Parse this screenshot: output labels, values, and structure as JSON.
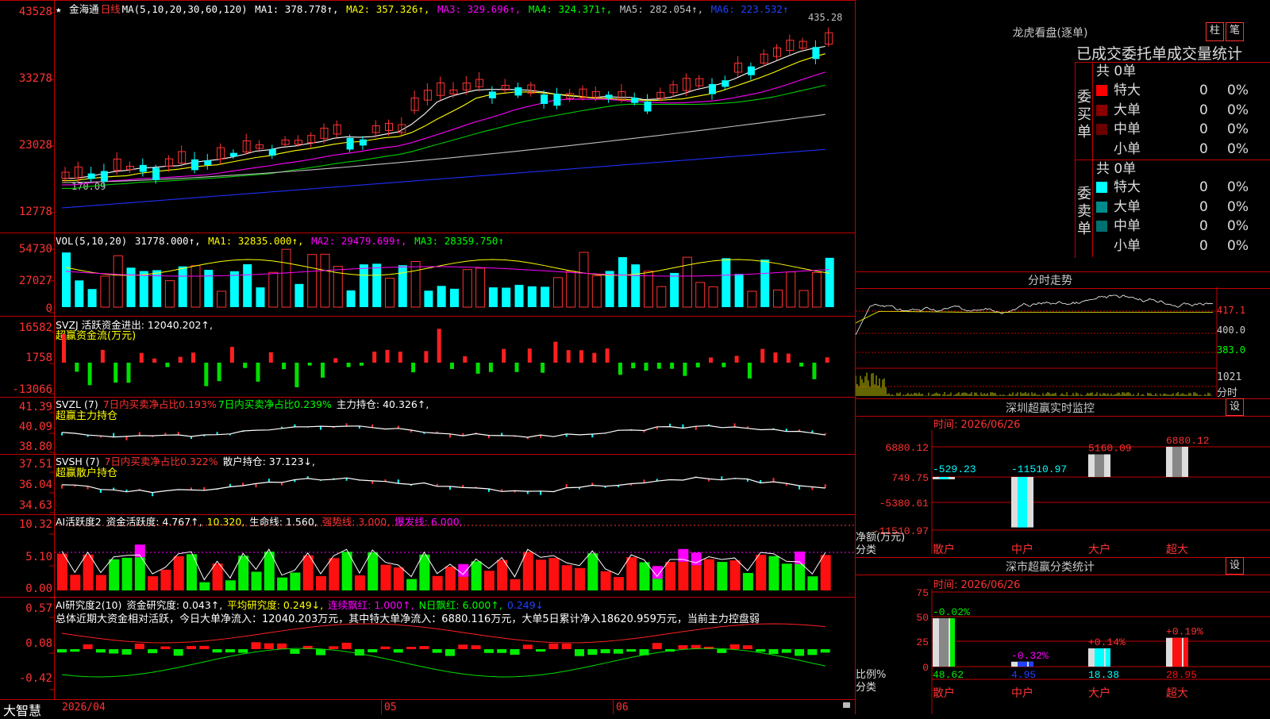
{
  "main": {
    "axis_labels": [
      "43528",
      "33278",
      "23028",
      "12778"
    ],
    "header": {
      "stock": "金海通",
      "period": "日线",
      "ma_params": "MA(5,10,20,30,60,120)",
      "ma1": "MA1: 378.778↑,",
      "ma2": "MA2: 357.326↑,",
      "ma3": "MA3: 329.696↑,",
      "ma4": "MA4: 324.371↑,",
      "ma5": "MA5: 282.054↑,",
      "ma6": "MA6: 223.532↑"
    },
    "high_label": "435.28",
    "low_label": "170.09"
  },
  "vol": {
    "axis_labels": [
      "54730",
      "27027",
      "0"
    ],
    "header": {
      "params": "VOL(5,10,20)",
      "value": "31778.000↑,",
      "ma1": "MA1: 32835.000↑,",
      "ma2": "MA2: 29479.699↑,",
      "ma3": "MA3: 28359.750↑"
    }
  },
  "svzj": {
    "axis_labels": [
      "16582",
      "1758",
      "-13066"
    ],
    "line1": "SVZJ  活跃资金进出: 12040.202↑,",
    "line2": "超赢资金流(万元)"
  },
  "svzl": {
    "axis_labels": [
      "41.39",
      "40.09",
      "38.80"
    ],
    "p1": "SVZL (7)",
    "p2": "7日内买卖净占比0.193%",
    "p3": "7日内买卖净占比0.239%",
    "p4": "主力持仓: 40.326↑,",
    "line2": "超赢主力持仓"
  },
  "svsh": {
    "axis_labels": [
      "37.51",
      "36.04",
      "34.63"
    ],
    "p1": "SVSH (7)",
    "p2": "7日内买卖净占比0.322%",
    "p3": "散户持仓: 37.123↓,",
    "line2": "超赢散户持仓"
  },
  "ai2": {
    "axis_labels": [
      "10.32",
      "5.10",
      "0.00"
    ],
    "p1": "AI活跃度2",
    "p2": "资金活跃度: 4.767↑,",
    "p3": "10.320,",
    "p4": "生命线: 1.560,",
    "p5": "强势线: 3.000,",
    "p6": "爆发线: 6.000,"
  },
  "ai_research": {
    "axis_labels": [
      "0.57",
      "0.08",
      "-0.42"
    ],
    "p1": "AI研究度2(10)",
    "p2": "资金研究度: 0.043↑,",
    "p3": "平均研究度: 0.249↓,",
    "p4": "连续飘红: 1.000↑,",
    "p5": "N日飘红: 6.000↑,",
    "p6": "0.249↓",
    "summary": "总体近期大资金相对活跃，今日大单净流入：12040.203万元，其中特大单净流入：6880.116万元，大单5日累计净入18620.959万元，当前主力控盘弱"
  },
  "footer": {
    "brand": "大智慧",
    "date1": "2026/04",
    "date2": "05",
    "date3": "06"
  },
  "dragon": {
    "title": "龙虎看盘(逐单)",
    "btn1": "柱",
    "btn2": "笔",
    "tabs": "已成交委托单成交量统计",
    "buy_label": "委买单",
    "sell_label": "委卖单",
    "buy_total": "共 0单",
    "sell_total": "共 0单",
    "buy_rows": [
      {
        "name": "特大",
        "count": "0",
        "pct": "0%",
        "color": "#ff0000"
      },
      {
        "name": "大单",
        "count": "0",
        "pct": "0%",
        "color": "#8b0000"
      },
      {
        "name": "中单",
        "count": "0",
        "pct": "0%",
        "color": "#6b0000"
      },
      {
        "name": "小单",
        "count": "0",
        "pct": "0%",
        "color": "#000000"
      }
    ],
    "sell_rows": [
      {
        "name": "特大",
        "count": "0",
        "pct": "0%",
        "color": "#00ffff"
      },
      {
        "name": "大单",
        "count": "0",
        "pct": "0%",
        "color": "#008b8b"
      },
      {
        "name": "中单",
        "count": "0",
        "pct": "0%",
        "color": "#007070"
      },
      {
        "name": "小单",
        "count": "0",
        "pct": "0%",
        "color": "#000000"
      }
    ]
  },
  "intraday": {
    "title": "分时走势",
    "price_hi": "417.1",
    "price_mid": "400.0",
    "price_lo": "383.0",
    "vol_label": "1021",
    "vol_unit": "分时"
  },
  "monitor": {
    "title": "深圳超赢实时监控",
    "set": "设",
    "time": "时间: 2026/06/26",
    "axis": [
      "6880.12",
      "749.75",
      "-5380.61",
      "-11510.97"
    ],
    "ylabel": "净额(万元)",
    "xlabel": "分类",
    "categories": [
      "散户",
      "中户",
      "大户",
      "超大"
    ],
    "values": [
      "-529.23",
      "-11510.97",
      "5160.09",
      "6880.12"
    ]
  },
  "classify": {
    "title": "深市超赢分类统计",
    "set": "设",
    "time": "时间: 2026/06/26",
    "axis": [
      "75",
      "50",
      "25",
      "0"
    ],
    "ylabel": "比例%",
    "xlabel": "分类",
    "categories": [
      "散户",
      "中户",
      "大户",
      "超大"
    ],
    "changes": [
      "-0.02%",
      "-0.32%",
      "+0.14%",
      "+0.19%"
    ],
    "values": [
      "48.62",
      "4.95",
      "18.38",
      "28.95"
    ]
  }
}
